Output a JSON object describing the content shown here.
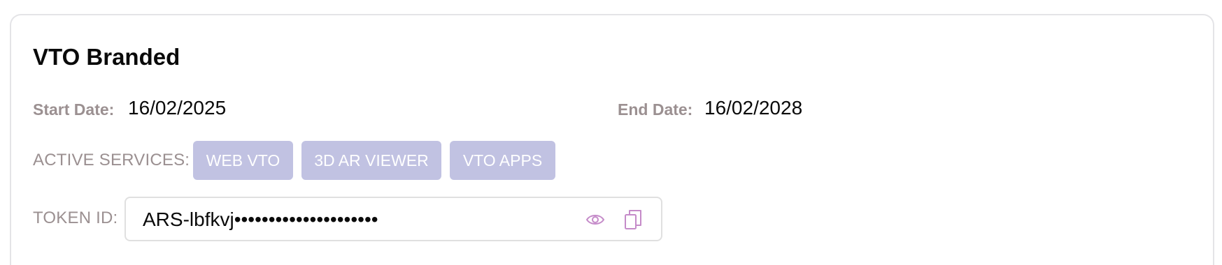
{
  "card": {
    "title": "VTO Branded",
    "start_date": {
      "label": "Start Date:",
      "value": "16/02/2025"
    },
    "end_date": {
      "label": "End Date:",
      "value": "16/02/2028"
    },
    "active_services": {
      "label": "ACTIVE SERVICES:",
      "chips": [
        "WEB VTO",
        "3D AR VIEWER",
        "VTO APPS"
      ]
    },
    "token": {
      "label": "TOKEN ID:",
      "value": "ARS-lbfkvj•••••••••••••••••••••",
      "icons": [
        "eye-icon",
        "copy-icon"
      ]
    }
  },
  "colors": {
    "label": "#9b9091",
    "chip_bg": "#c1c2e2",
    "icon": "#c58bc9",
    "border": "#e4e4e7"
  }
}
